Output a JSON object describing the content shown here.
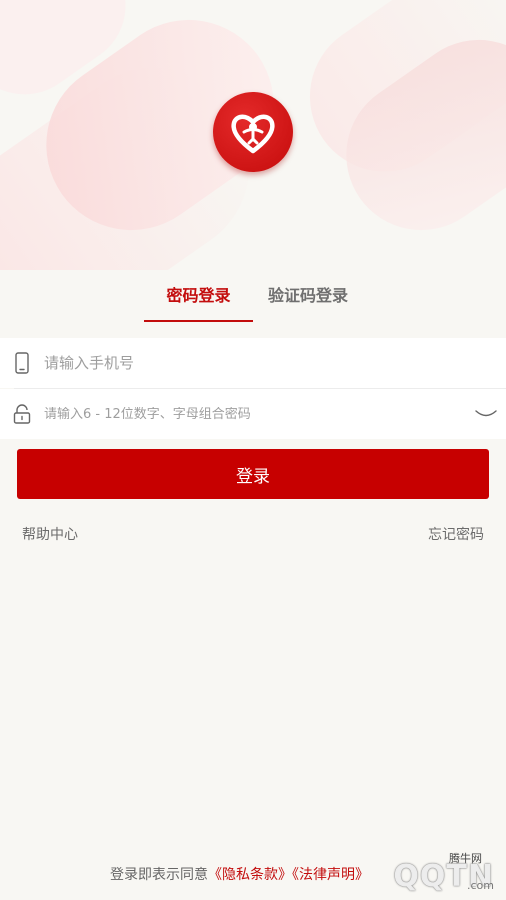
{
  "tabs": {
    "password_login": "密码登录",
    "code_login": "验证码登录"
  },
  "phone": {
    "placeholder": "请输入手机号"
  },
  "password": {
    "placeholder": "请输入6 - 12位数字、字母组合密码"
  },
  "login_button": "登录",
  "help_center": "帮助中心",
  "forgot_password": "忘记密码",
  "agreement": {
    "prefix": "登录即表示同意",
    "privacy": "《隐私条款》",
    "statement": "《法律声明》"
  },
  "watermark": {
    "cn": "腾牛网",
    "text": "QQTN",
    "suffix": ".com"
  },
  "colors": {
    "brand": "#c70000",
    "background": "#f8f7f3"
  }
}
